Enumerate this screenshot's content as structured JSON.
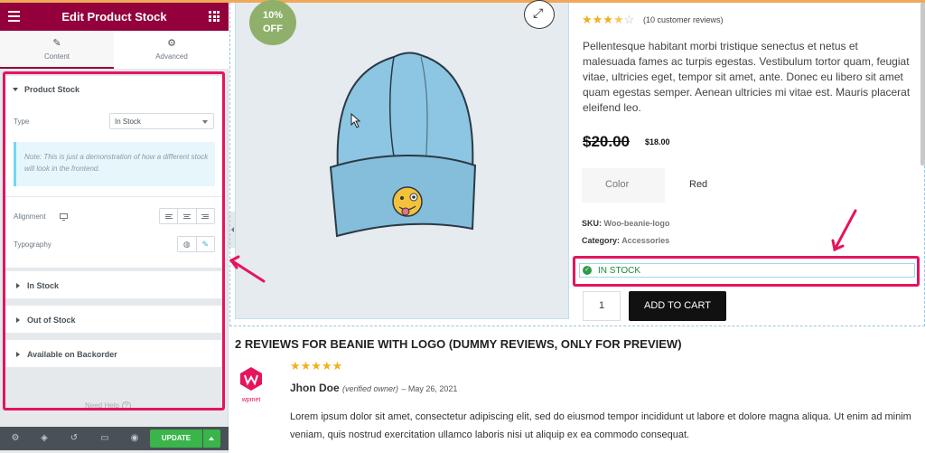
{
  "editor": {
    "title": "Edit Product Stock",
    "tabs": [
      {
        "label": "Content"
      },
      {
        "label": "Advanced"
      }
    ],
    "section_title": "Product Stock",
    "type_label": "Type",
    "type_value": "In Stock",
    "note": "Note: This is just a demonstration of how a different stock will look in the frontend.",
    "alignment_label": "Alignment",
    "typography_label": "Typography",
    "collapsed_sections": [
      "In Stock",
      "Out of Stock",
      "Available on Backorder"
    ],
    "need_help": "Need Help",
    "update_label": "UPDATE"
  },
  "product": {
    "discount_badge_line1": "10%",
    "discount_badge_line2": "OFF",
    "rating": 3.5,
    "reviews_count": "(10 customer reviews)",
    "description": "Pellentesque habitant morbi tristique senectus et netus et malesuada fames ac turpis egestas. Vestibulum tortor quam, feugiat vitae, ultricies eget, tempor sit amet, ante. Donec eu libero sit amet quam egestas semper. Aenean ultricies mi vitae est. Mauris placerat eleifend leo.",
    "old_price": "$20.00",
    "new_price": "$18.00",
    "attribute_name": "Color",
    "attribute_value": "Red",
    "sku_label": "SKU:",
    "sku_value": "Woo-beanie-logo",
    "category_label": "Category:",
    "category_value": "Accessories",
    "stock_status": "IN STOCK",
    "quantity": "1",
    "add_to_cart": "ADD TO CART"
  },
  "reviews": {
    "heading": "2 REVIEWS FOR BEANIE WITH LOGO (DUMMY REVIEWS, ONLY FOR PREVIEW)",
    "avatar_text": "wpmet",
    "items": [
      {
        "stars": 5,
        "author": "Jhon Doe",
        "verified": "(verified owner)",
        "date": "– May 26, 2021",
        "text": "Lorem ipsum dolor sit amet, consectetur adipiscing elit, sed do eiusmod tempor incididunt ut labore et dolore magna aliqua. Ut enim ad minim veniam, quis nostrud exercitation ullamco laboris nisi ut aliquip ex ea commodo consequat."
      }
    ]
  },
  "colors": {
    "brand": "#93003c",
    "annotation": "#e5145e",
    "update_green": "#39b54a",
    "star": "#f2b01e",
    "in_stock": "#1e8a3a"
  }
}
